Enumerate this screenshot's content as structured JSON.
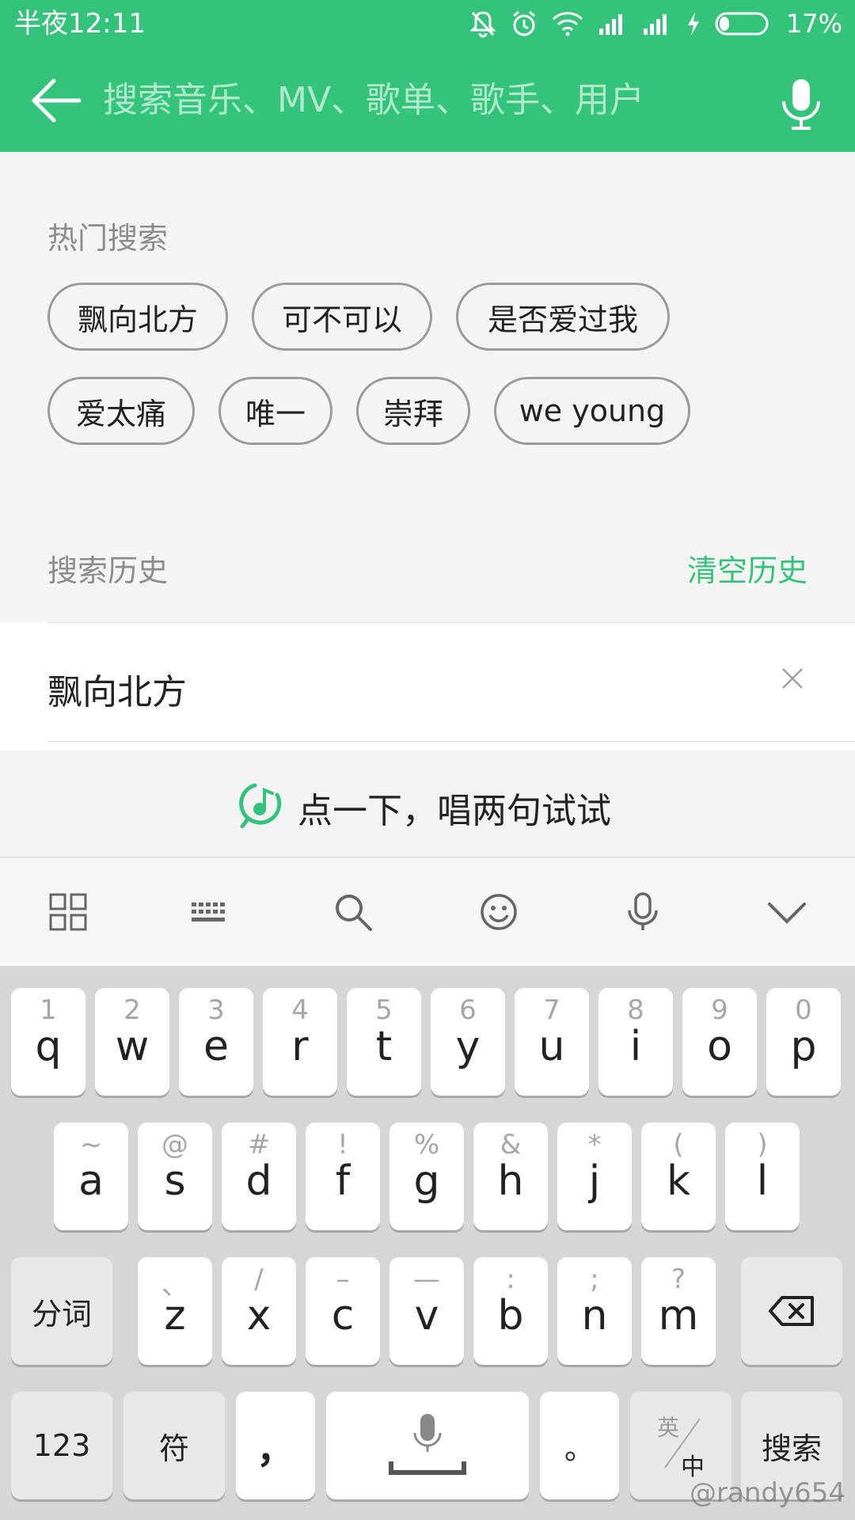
{
  "status_bar": {
    "time": "半夜12:11",
    "battery": "17%"
  },
  "search": {
    "placeholder": "搜索音乐、MV、歌单、歌手、用户"
  },
  "hot_search": {
    "title": "热门搜索",
    "tags": [
      "飘向北方",
      "可不可以",
      "是否爱过我",
      "爱太痛",
      "唯一",
      "崇拜",
      "we young"
    ]
  },
  "history": {
    "title": "搜索历史",
    "clear_label": "清空历史",
    "items": [
      "飘向北方"
    ]
  },
  "hum_prompt": "点一下，唱两句试试",
  "keyboard": {
    "row1": [
      {
        "hint": "1",
        "letter": "q"
      },
      {
        "hint": "2",
        "letter": "w"
      },
      {
        "hint": "3",
        "letter": "e"
      },
      {
        "hint": "4",
        "letter": "r"
      },
      {
        "hint": "5",
        "letter": "t"
      },
      {
        "hint": "6",
        "letter": "y"
      },
      {
        "hint": "7",
        "letter": "u"
      },
      {
        "hint": "8",
        "letter": "i"
      },
      {
        "hint": "9",
        "letter": "o"
      },
      {
        "hint": "0",
        "letter": "p"
      }
    ],
    "row2": [
      {
        "hint": "~",
        "letter": "a"
      },
      {
        "hint": "@",
        "letter": "s"
      },
      {
        "hint": "#",
        "letter": "d"
      },
      {
        "hint": "!",
        "letter": "f"
      },
      {
        "hint": "%",
        "letter": "g"
      },
      {
        "hint": "&",
        "letter": "h"
      },
      {
        "hint": "*",
        "letter": "j"
      },
      {
        "hint": "(",
        "letter": "k"
      },
      {
        "hint": ")",
        "letter": "l"
      }
    ],
    "row3": [
      {
        "hint": "、",
        "letter": "z"
      },
      {
        "hint": "/",
        "letter": "x"
      },
      {
        "hint": "–",
        "letter": "c"
      },
      {
        "hint": "—",
        "letter": "v"
      },
      {
        "hint": ":",
        "letter": "b"
      },
      {
        "hint": ";",
        "letter": "n"
      },
      {
        "hint": "?",
        "letter": "m"
      }
    ],
    "segment_label": "分词",
    "numbers_label": "123",
    "symbols_label": "符",
    "comma_label": "，",
    "period_label": "。",
    "lang_en": "英",
    "lang_zh": "中",
    "search_label": "搜索"
  },
  "watermark": "@randy654",
  "colors": {
    "accent": "#33c37a"
  }
}
